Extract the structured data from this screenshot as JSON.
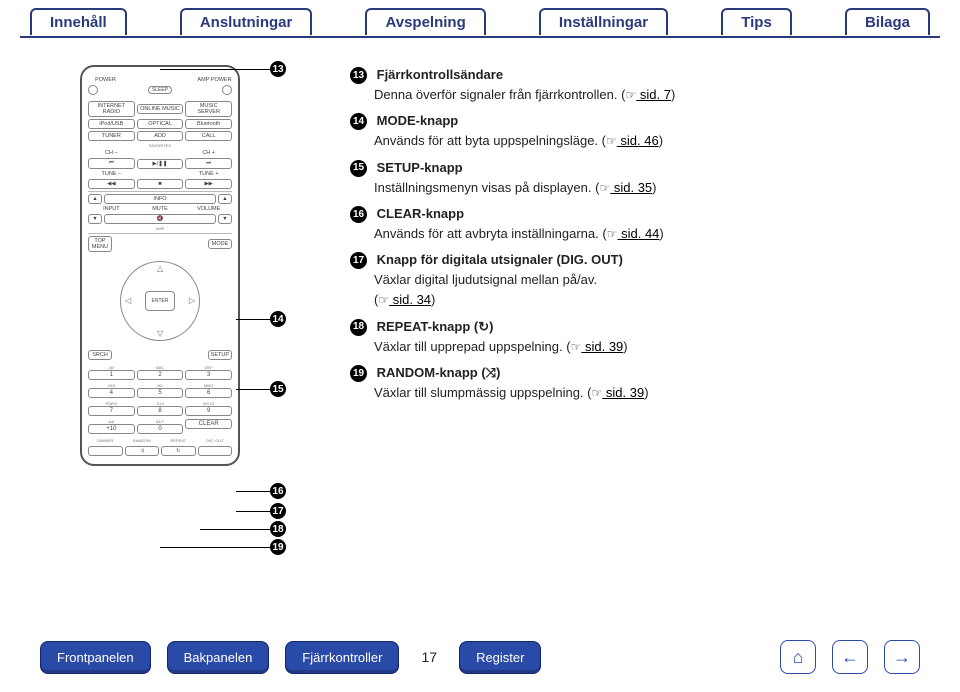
{
  "topnav": {
    "tabs": [
      "Innehåll",
      "Anslutningar",
      "Avspelning",
      "Inställningar",
      "Tips",
      "Bilaga"
    ]
  },
  "remote": {
    "power": "POWER",
    "amp_power": "AMP POWER",
    "sleep": "SLEEP",
    "row_src1": [
      "INTERNET RADIO",
      "ONLINE MUSIC",
      "MUSIC SERVER"
    ],
    "row_src2": [
      "iPod/USB",
      "OPTICAL",
      "Bluetooth"
    ],
    "row_src3": [
      "TUNER",
      "ADD",
      "CALL"
    ],
    "favorites": "FAVORITES",
    "ch_minus": "CH –",
    "ch_plus": "CH +",
    "tune_minus": "TUNE –",
    "tune_plus": "TUNE +",
    "info": "INFO",
    "input": "INPUT",
    "mute": "MUTE",
    "volume": "VOLUME",
    "amp": "AMP",
    "top_menu": "TOP MENU",
    "mode": "MODE",
    "enter": "ENTER",
    "srch": "SRCH",
    "setup": "SETUP",
    "keypad_labels": [
      ".@/",
      "ABC",
      "DEF",
      "GHI",
      "JKL",
      "MNO",
      "PQRS",
      "TUV",
      "WXYZ",
      "a/A",
      "0&!?",
      ""
    ],
    "keypad_keys": [
      "1",
      "2",
      "3",
      "4",
      "5",
      "6",
      "7",
      "8",
      "9",
      "+10",
      "0",
      "CLEAR"
    ],
    "bottom_row_labels": [
      "DIMMER",
      "RANDOM",
      "REPEAT",
      "DIG. OUT"
    ],
    "bottom_row_icons": [
      "",
      "⤨",
      "↻",
      ""
    ]
  },
  "callouts": {
    "m13": "13",
    "m14": "14",
    "m15": "15",
    "m16": "16",
    "m17": "17",
    "m18": "18",
    "m19": "19"
  },
  "descriptions": [
    {
      "num": "13",
      "title": "Fjärrkontrollsändare",
      "body": "Denna överför signaler från fjärrkontrollen.",
      "link": " sid. 7"
    },
    {
      "num": "14",
      "title": "MODE-knapp",
      "body": "Används för att byta uppspelningsläge.",
      "link": " sid. 46"
    },
    {
      "num": "15",
      "title": "SETUP-knapp",
      "body": "Inställningsmenyn visas på displayen.",
      "link": " sid. 35"
    },
    {
      "num": "16",
      "title": "CLEAR-knapp",
      "body": "Används för att avbryta inställningarna.",
      "link": " sid. 44"
    },
    {
      "num": "17",
      "title": "Knapp för digitala utsignaler (DIG. OUT)",
      "body": "Växlar digital ljudutsignal mellan på/av.",
      "link": " sid. 34"
    },
    {
      "num": "18",
      "title": "REPEAT-knapp (↻)",
      "body": "Växlar till upprepad uppspelning.",
      "link": " sid. 39"
    },
    {
      "num": "19",
      "title": "RANDOM-knapp (⤨)",
      "body": "Växlar till slumpmässig uppspelning.",
      "link": " sid. 39"
    }
  ],
  "bottom": {
    "buttons": [
      "Frontpanelen",
      "Bakpanelen",
      "Fjärrkontroller",
      "Register"
    ],
    "page": "17",
    "icons": {
      "home": "⌂",
      "prev": "←",
      "next": "→"
    }
  },
  "paren_open": "(",
  "paren_close": ")",
  "hand_glyph": "☞"
}
